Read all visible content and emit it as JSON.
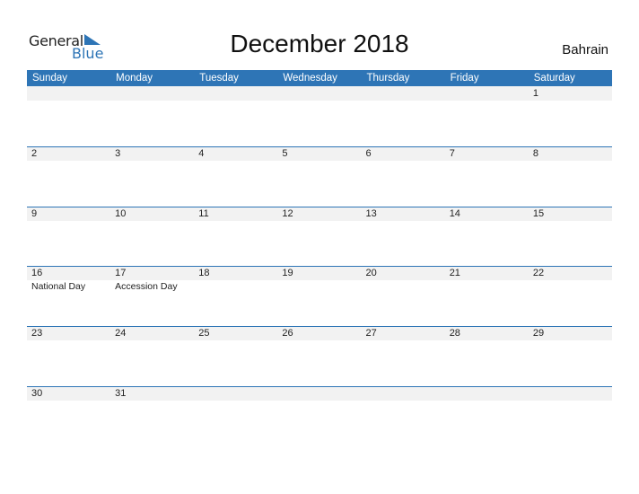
{
  "logo": {
    "general": "General",
    "blue": "Blue"
  },
  "title": "December 2018",
  "country": "Bahrain",
  "colors": {
    "accent": "#2e75b6",
    "strip": "#f2f2f2"
  },
  "weekdays": [
    "Sunday",
    "Monday",
    "Tuesday",
    "Wednesday",
    "Thursday",
    "Friday",
    "Saturday"
  ],
  "weeks": [
    [
      {
        "d": ""
      },
      {
        "d": ""
      },
      {
        "d": ""
      },
      {
        "d": ""
      },
      {
        "d": ""
      },
      {
        "d": ""
      },
      {
        "d": "1"
      }
    ],
    [
      {
        "d": "2"
      },
      {
        "d": "3"
      },
      {
        "d": "4"
      },
      {
        "d": "5"
      },
      {
        "d": "6"
      },
      {
        "d": "7"
      },
      {
        "d": "8"
      }
    ],
    [
      {
        "d": "9"
      },
      {
        "d": "10"
      },
      {
        "d": "11"
      },
      {
        "d": "12"
      },
      {
        "d": "13"
      },
      {
        "d": "14"
      },
      {
        "d": "15"
      }
    ],
    [
      {
        "d": "16",
        "e": "National Day"
      },
      {
        "d": "17",
        "e": "Accession Day"
      },
      {
        "d": "18"
      },
      {
        "d": "19"
      },
      {
        "d": "20"
      },
      {
        "d": "21"
      },
      {
        "d": "22"
      }
    ],
    [
      {
        "d": "23"
      },
      {
        "d": "24"
      },
      {
        "d": "25"
      },
      {
        "d": "26"
      },
      {
        "d": "27"
      },
      {
        "d": "28"
      },
      {
        "d": "29"
      }
    ],
    [
      {
        "d": "30"
      },
      {
        "d": "31"
      },
      {
        "d": ""
      },
      {
        "d": ""
      },
      {
        "d": ""
      },
      {
        "d": ""
      },
      {
        "d": ""
      }
    ]
  ]
}
